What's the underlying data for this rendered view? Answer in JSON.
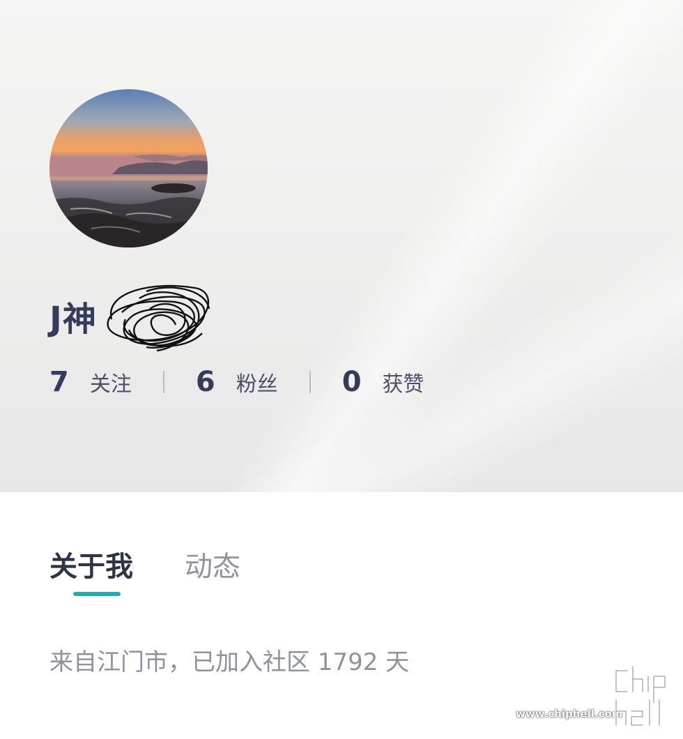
{
  "profile": {
    "username": "J神",
    "avatar_icon": "sunset-seascape-avatar"
  },
  "stats": [
    {
      "count": "7",
      "label": "关注"
    },
    {
      "count": "6",
      "label": "粉丝"
    },
    {
      "count": "0",
      "label": "获赞"
    }
  ],
  "tabs": {
    "about_label": "关于我",
    "activity_label": "动态",
    "accent_color": "#24aab0"
  },
  "about": {
    "intro_text": "来自江门市，已加入社区 1792 天"
  },
  "watermark": {
    "url_text": "www.chiphell.com",
    "logo_icon": "chiphell-logo-icon"
  },
  "colors": {
    "primary_text": "#353c57",
    "secondary_text": "#8e929e"
  }
}
